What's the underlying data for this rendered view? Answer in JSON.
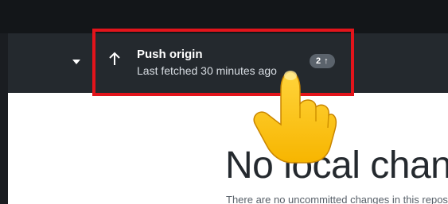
{
  "toolbar": {
    "push": {
      "title": "Push origin",
      "subtitle": "Last fetched 30 minutes ago",
      "badge_count": "2",
      "badge_arrow": "↑",
      "arrow_icon": "arrow-up-icon"
    },
    "dropdown_icon": "caret-down-icon"
  },
  "annotation": {
    "highlight_color": "#e3141b",
    "pointer": "pointing-hand-icon"
  },
  "main": {
    "heading": "No local changes",
    "subtext": "There are no uncommitted changes in this repository."
  },
  "colors": {
    "titlebar": "#131619",
    "toolbar": "#24292e",
    "badge": "#5b636c"
  }
}
